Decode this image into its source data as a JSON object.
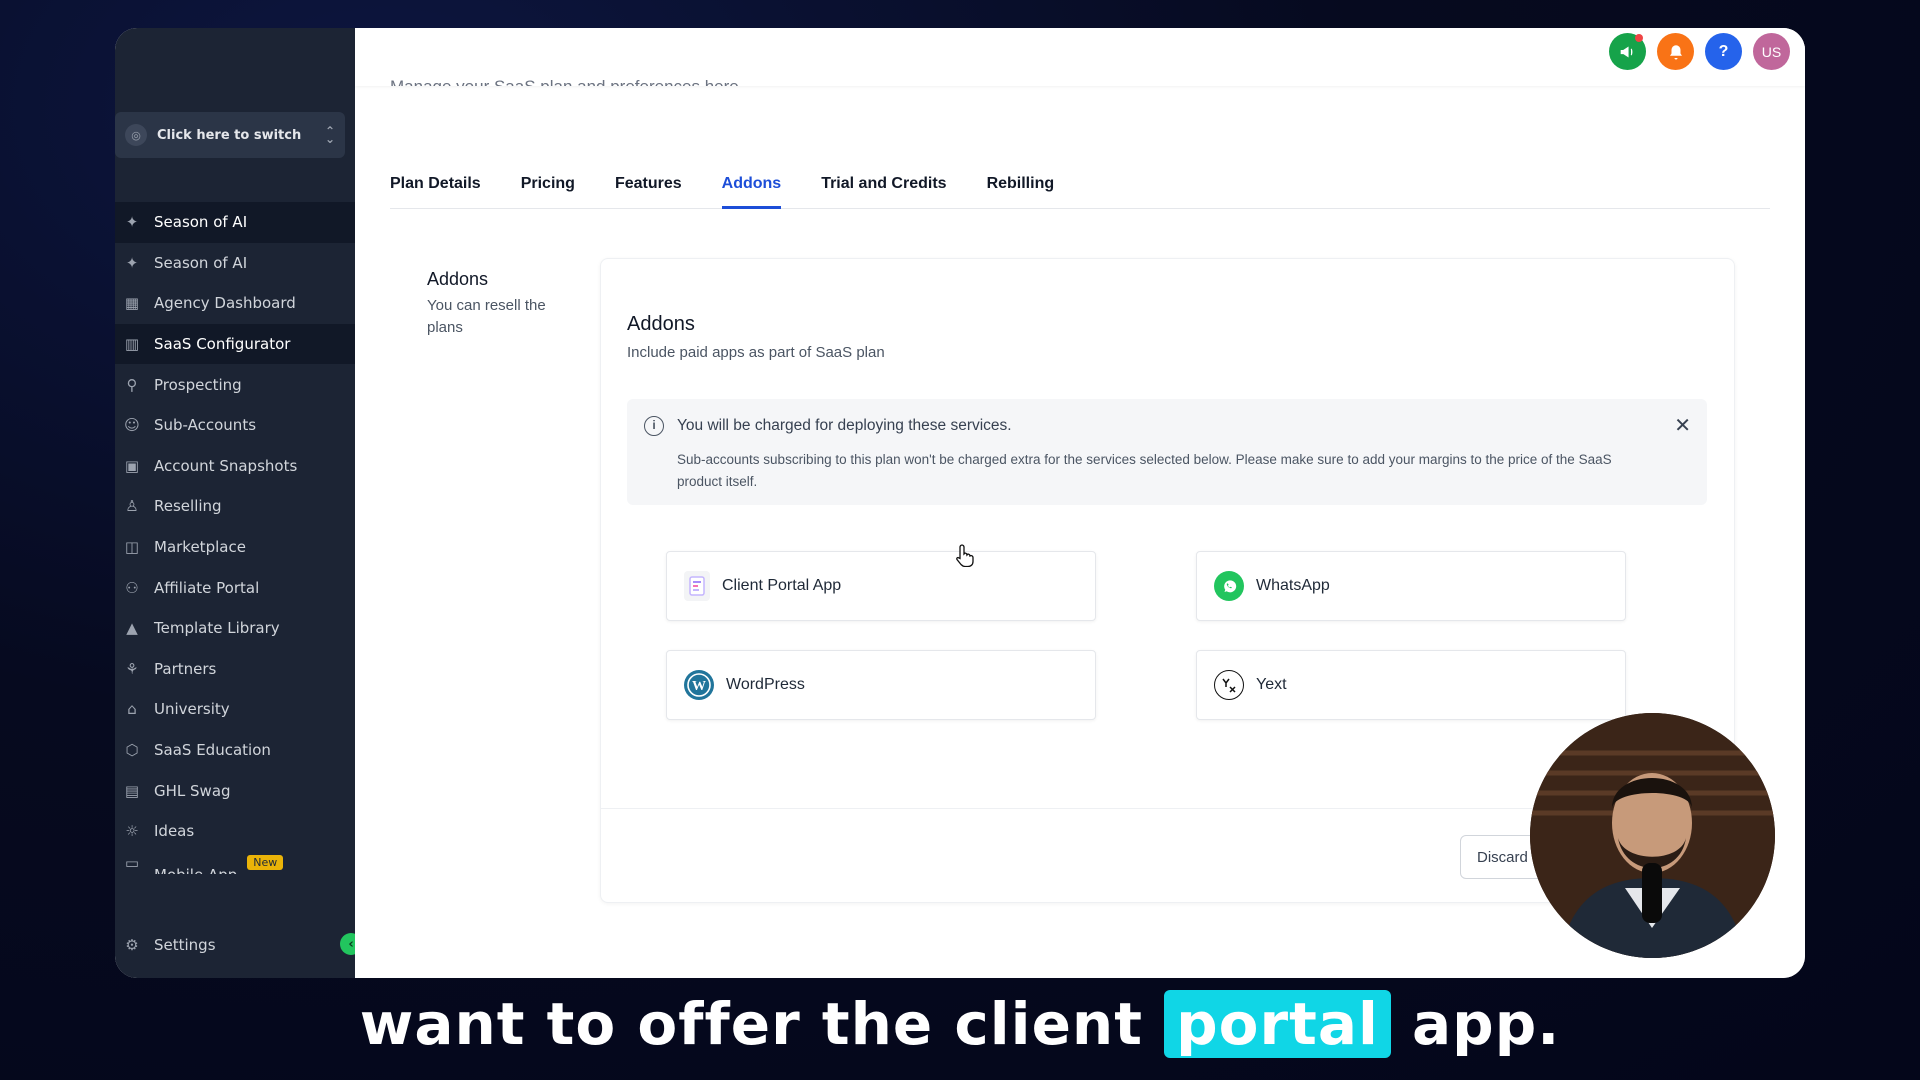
{
  "sidebar": {
    "switcher_label": "Click here to switch",
    "items": [
      {
        "label": "Season of AI",
        "icon": "sparkle-icon",
        "active": true
      },
      {
        "label": "Season of AI",
        "icon": "sparkle-icon",
        "active": false
      },
      {
        "label": "Agency Dashboard",
        "icon": "dashboard-icon",
        "active": false
      },
      {
        "label": "SaaS Configurator",
        "icon": "bar-chart-icon",
        "active": true
      },
      {
        "label": "Prospecting",
        "icon": "user-search-icon",
        "active": false
      },
      {
        "label": "Sub-Accounts",
        "icon": "user-icon",
        "active": false
      },
      {
        "label": "Account Snapshots",
        "icon": "snapshot-icon",
        "active": false
      },
      {
        "label": "Reselling",
        "icon": "hierarchy-icon",
        "active": false
      },
      {
        "label": "Marketplace",
        "icon": "bag-icon",
        "active": false
      },
      {
        "label": "Affiliate Portal",
        "icon": "users-icon",
        "active": false
      },
      {
        "label": "Template Library",
        "icon": "shapes-icon",
        "active": false
      },
      {
        "label": "Partners",
        "icon": "handshake-icon",
        "active": false
      },
      {
        "label": "University",
        "icon": "graduation-cap-icon",
        "active": false
      },
      {
        "label": "SaaS Education",
        "icon": "box-icon",
        "active": false
      },
      {
        "label": "GHL Swag",
        "icon": "store-icon",
        "active": false
      },
      {
        "label": "Ideas",
        "icon": "lightbulb-icon",
        "active": false
      }
    ],
    "partial_item_label": "Mobile App",
    "partial_item_badge": "New",
    "settings_label": "Settings"
  },
  "header": {
    "subtitle": "Manage your SaaS plan and preferences here.",
    "icons": [
      {
        "name": "megaphone-icon",
        "color": "#16a34a",
        "glyph": "📢",
        "dot": true
      },
      {
        "name": "bell-icon",
        "color": "#f97316",
        "glyph": "🔔",
        "dot": false
      },
      {
        "name": "help-icon",
        "color": "#2563eb",
        "glyph": "?",
        "dot": false
      },
      {
        "name": "avatar-icon",
        "color": "#c0679b",
        "glyph": "US",
        "dot": false
      }
    ]
  },
  "tabs": [
    {
      "label": "Plan Details",
      "active": false
    },
    {
      "label": "Pricing",
      "active": false
    },
    {
      "label": "Features",
      "active": false
    },
    {
      "label": "Addons",
      "active": true
    },
    {
      "label": "Trial and Credits",
      "active": false
    },
    {
      "label": "Rebilling",
      "active": false
    }
  ],
  "section": {
    "title": "Addons",
    "description": "You can resell the plans"
  },
  "card": {
    "title": "Addons",
    "subtitle": "Include paid apps as part of SaaS plan",
    "alert": {
      "title": "You will be charged for deploying these services.",
      "description": "Sub-accounts subscribing to this plan won't be charged extra for the services selected below. Please make sure to add your margins to the price of the SaaS product itself."
    },
    "apps": [
      {
        "label": "Client Portal App",
        "icon": "client-portal-icon"
      },
      {
        "label": "WhatsApp",
        "icon": "whatsapp-icon"
      },
      {
        "label": "WordPress",
        "icon": "wordpress-icon"
      },
      {
        "label": "Yext",
        "icon": "yext-icon"
      }
    ]
  },
  "footer": {
    "discard_label": "Discard"
  },
  "caption": {
    "before": "want to offer the client",
    "highlight": "portal",
    "after": "app."
  }
}
